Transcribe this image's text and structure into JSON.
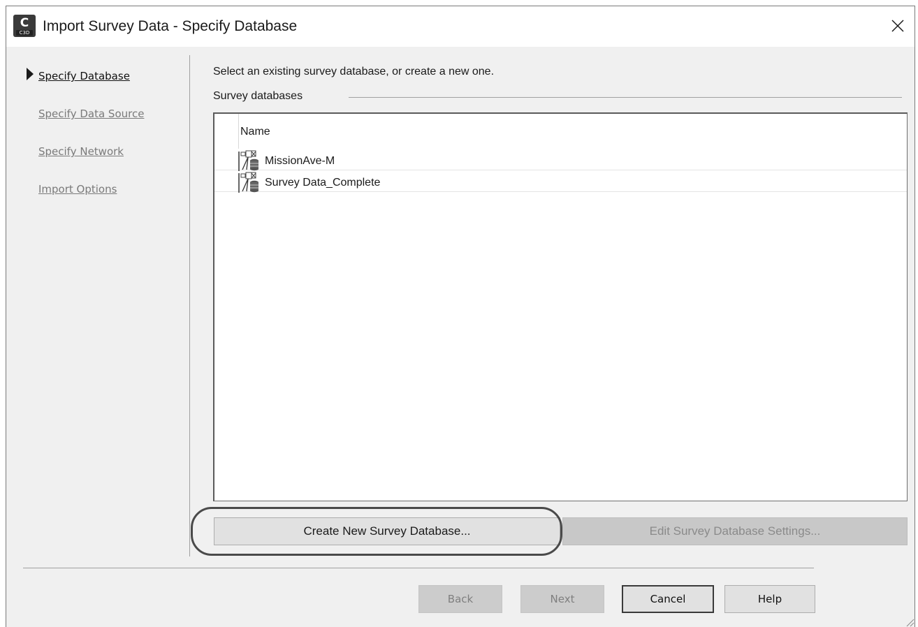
{
  "window": {
    "title": "Import Survey Data - Specify Database",
    "app_icon_text": "C",
    "app_icon_subtext": "C3D",
    "close_symbol": "✕"
  },
  "nav": {
    "items": [
      {
        "label": "Specify Database",
        "active": true
      },
      {
        "label": "Specify Data Source",
        "active": false
      },
      {
        "label": "Specify Network",
        "active": false
      },
      {
        "label": "Import Options",
        "active": false
      }
    ]
  },
  "main": {
    "instruction": "Select an existing survey database, or create a new one.",
    "group_label": "Survey databases",
    "list": {
      "column_header": "Name",
      "rows": [
        {
          "name": "MissionAve-M",
          "icon": "survey-database-icon"
        },
        {
          "name": "Survey Data_Complete",
          "icon": "survey-database-icon"
        }
      ]
    },
    "create_button": "Create New Survey Database...",
    "edit_button": "Edit Survey Database Settings..."
  },
  "footer": {
    "back": "Back",
    "next": "Next",
    "cancel": "Cancel",
    "help": "Help"
  },
  "colors": {
    "window_bg": "#f0f0f0",
    "disabled_button": "#cccccc",
    "highlight_ring": "#4a4a4a"
  }
}
